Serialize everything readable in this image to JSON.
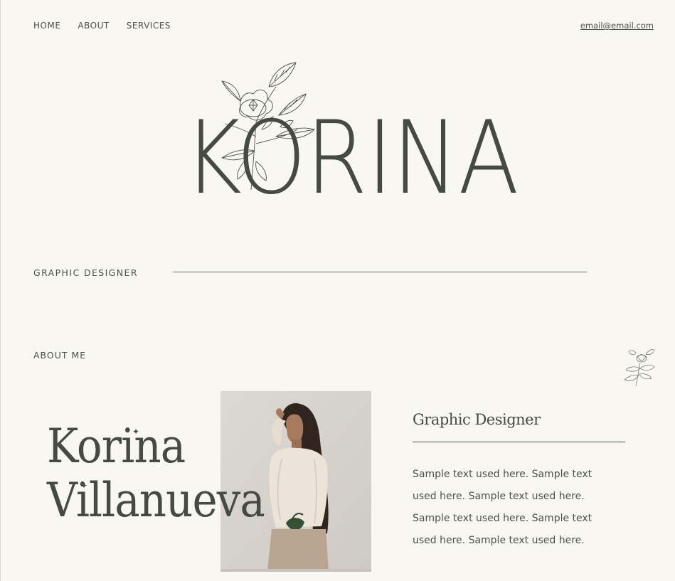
{
  "nav": {
    "items": [
      {
        "label": "HOME"
      },
      {
        "label": "ABOUT"
      },
      {
        "label": "SERVICES"
      }
    ],
    "email": "email@email.com"
  },
  "hero": {
    "brand": "KORINA",
    "tagline": "GRAPHIC DESIGNER",
    "flower_icon": "floral-line-drawing-icon"
  },
  "about": {
    "section_label": "ABOUT ME",
    "name_line1": "Korina",
    "name_line2": "Villanueva",
    "role_title": "Graphic Designer",
    "bio": "Sample text used here. Sample text used here. Sample text used here. Sample text used here. Sample text used here. Sample text used here.",
    "photo_alt": "portrait-photo"
  },
  "colors": {
    "background": "#f9f7f2",
    "text": "#454a42",
    "rule": "#6a6d66"
  }
}
